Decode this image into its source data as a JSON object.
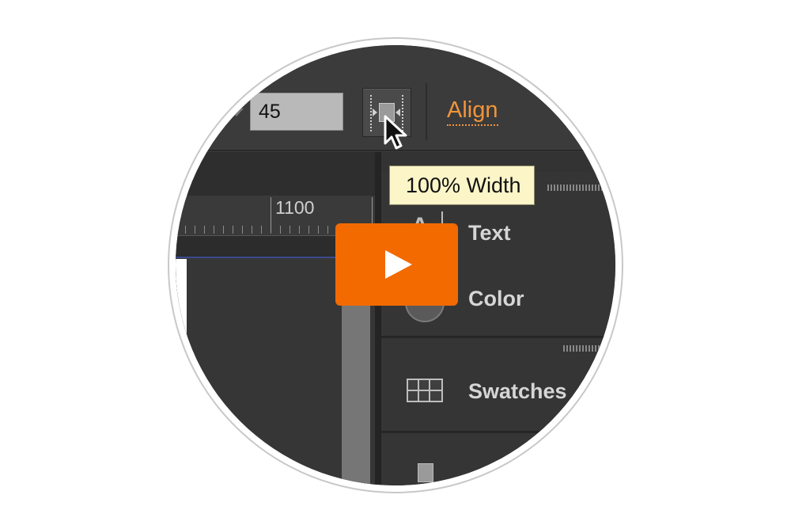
{
  "toolbar": {
    "number_value": "45",
    "align_label": "Align"
  },
  "tooltip": {
    "text": "100% Width"
  },
  "ruler": {
    "label": "1100"
  },
  "panels": {
    "text_label": "Text",
    "color_label": "Color",
    "swatches_label": "Swatches"
  },
  "icons": {
    "play": "play-icon",
    "cursor": "arrow-cursor-icon",
    "width": "full-width-icon",
    "swatches": "grid-swatches-icon",
    "color": "color-wheel-icon",
    "text": "text-glyph-icon"
  },
  "colors": {
    "accent": "#f0953b",
    "play_button": "#f26a00",
    "tooltip_bg": "#fbf5c8"
  }
}
